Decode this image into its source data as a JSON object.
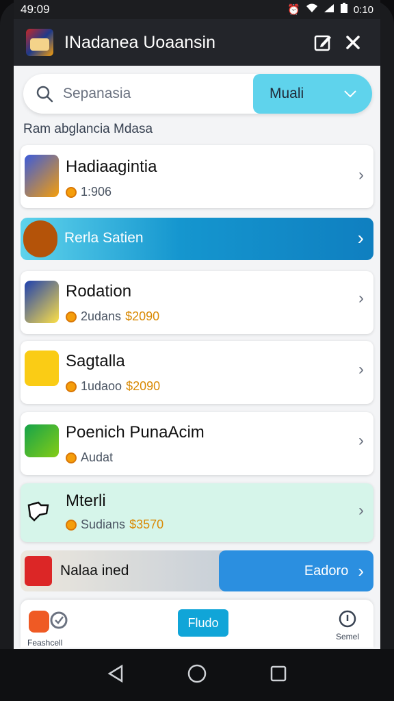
{
  "status": {
    "time": "49:09",
    "right_time": "0:10"
  },
  "app": {
    "title": "INadanea Uoaansin"
  },
  "search": {
    "placeholder": "Sepanasia",
    "filter_label": "Muali"
  },
  "section_title": "Ram abglancia Mdasa",
  "items": [
    {
      "title": "Hadiaagintia",
      "sub": "1:906",
      "price": ""
    },
    {
      "title": "Rodation",
      "sub": "2udans",
      "price": "$2090"
    },
    {
      "title": "Sagtalla",
      "sub": "1udaoo",
      "price": "$2090"
    },
    {
      "title": "Poenich PunaAcim",
      "sub": "Audat",
      "price": ""
    },
    {
      "title": "Mterli",
      "sub": "Sudians",
      "price": "$3570"
    }
  ],
  "banner1": {
    "label": "Rerla Satien"
  },
  "banner2": {
    "label": "Nalaa ined",
    "button": "Eadoro"
  },
  "bottom_nav": {
    "left_label": "Feashcell",
    "center": "Fludo",
    "right_label": "Semel"
  },
  "colors": {
    "accent": "#5fd3ec",
    "banner_blue": "#1596cf",
    "mint": "#d6f5ea",
    "coin": "#f59e0b"
  }
}
